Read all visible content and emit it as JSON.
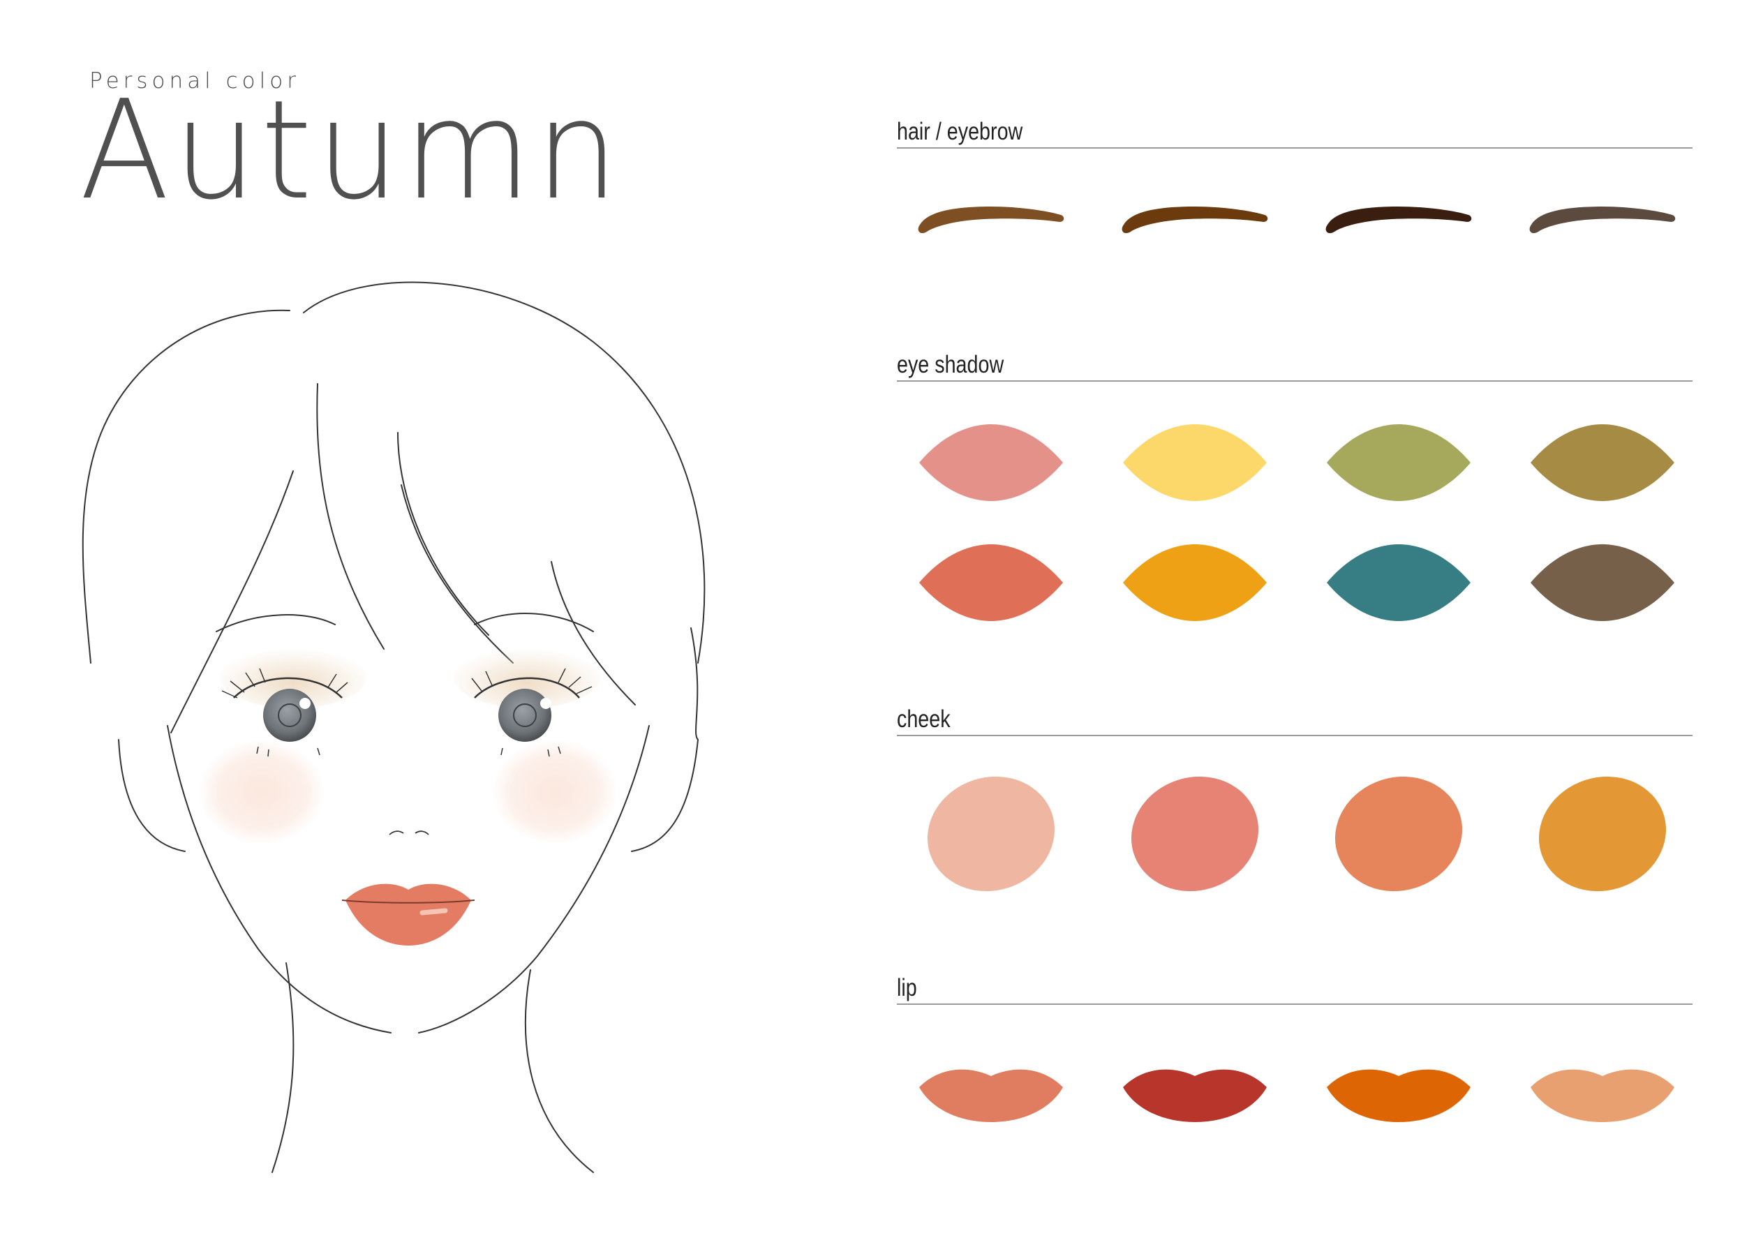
{
  "header": {
    "subtitle": "Personal color",
    "title": "Autumn"
  },
  "sections": [
    {
      "id": "hair-eyebrow",
      "label": "hair / eyebrow",
      "swatch_shape": "eyebrow",
      "colors": [
        "#7f4f24",
        "#6b3b0d",
        "#3a1e10",
        "#5c4a3f"
      ]
    },
    {
      "id": "eye-shadow",
      "label": "eye shadow",
      "swatch_shape": "leaf",
      "colors": [
        "#e4918a",
        "#fcd76a",
        "#a6a85c",
        "#a68b45",
        "#df7057",
        "#eea114",
        "#367d84",
        "#76604a"
      ]
    },
    {
      "id": "cheek",
      "label": "cheek",
      "swatch_shape": "oval",
      "colors": [
        "#efb6a1",
        "#e68374",
        "#e6845b",
        "#e49835"
      ]
    },
    {
      "id": "lip",
      "label": "lip",
      "swatch_shape": "lips",
      "colors": [
        "#e07c60",
        "#b7352b",
        "#de6504",
        "#e9a071"
      ]
    }
  ],
  "illustration": {
    "lip_color": "#e37c62",
    "cheek_color": "#fbe6dc",
    "eyeshadow_color": "#f0e2cf",
    "iris_color": "#7d8288",
    "line_color": "#333333"
  }
}
